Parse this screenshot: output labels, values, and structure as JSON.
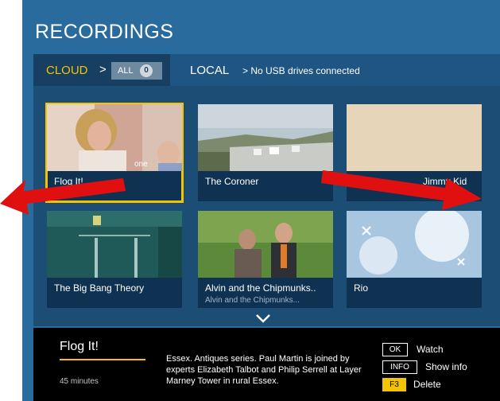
{
  "header": {
    "title": "RECORDINGS"
  },
  "tabs": {
    "cloud_label": "CLOUD",
    "cloud_chevron": ">",
    "all_label": "ALL",
    "all_count": "0",
    "local_label": "LOCAL",
    "local_note": "> No USB drives connected"
  },
  "recordings": [
    {
      "title": "Flog It!",
      "thumb_icon": "woman-with-child-thumbnail",
      "channel_logo": "one"
    },
    {
      "title": "The Coroner",
      "thumb_icon": "coastal-town-thumbnail"
    },
    {
      "title": "Jimmy Kid",
      "thumb_icon": "beige-blank-thumbnail"
    },
    {
      "title": "The Big Bang Theory",
      "thumb_icon": "teal-hallway-thumbnail"
    },
    {
      "title": "Alvin and the Chipmunks..",
      "subtitle": "Alvin and the Chipmunks...",
      "thumb_icon": "garden-couple-thumbnail"
    },
    {
      "title": "Rio",
      "thumb_icon": "snowy-bird-thumbnail"
    }
  ],
  "more_icon": "chevron-down-icon",
  "info": {
    "program_title": "Flog It!",
    "duration": "45 minutes",
    "description": "Essex. Antiques series. Paul Martin is joined by experts Elizabeth Talbot and Philip Serrell at Layer Marney Tower in rural Essex."
  },
  "actions": [
    {
      "key": "OK",
      "label": "Watch"
    },
    {
      "key": "INFO",
      "label": "Show info"
    },
    {
      "key": "F3",
      "label": "Delete"
    }
  ],
  "colors": {
    "accent": "#f5c400",
    "panel": "#2a6b9e",
    "arrow": "#e01010"
  }
}
